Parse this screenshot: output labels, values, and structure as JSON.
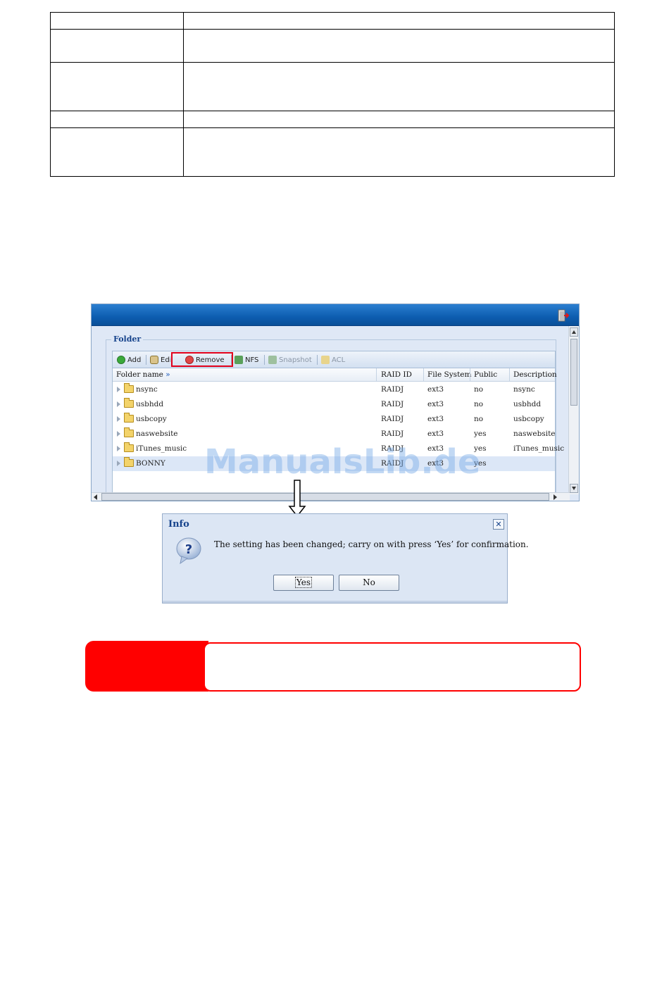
{
  "window": {
    "legend": "Folder",
    "toolbar": {
      "add": "Add",
      "edit": "Edit",
      "remove": "Remove",
      "nfs": "NFS",
      "snapshot": "Snapshot",
      "acl": "ACL"
    },
    "columns": [
      "Folder name",
      "RAID ID",
      "File System",
      "Public",
      "Description"
    ],
    "rows": [
      {
        "name": "nsync",
        "raid": "RAIDJ",
        "fs": "ext3",
        "public": "no",
        "desc": "nsync"
      },
      {
        "name": "usbhdd",
        "raid": "RAIDJ",
        "fs": "ext3",
        "public": "no",
        "desc": "usbhdd"
      },
      {
        "name": "usbcopy",
        "raid": "RAIDJ",
        "fs": "ext3",
        "public": "no",
        "desc": "usbcopy"
      },
      {
        "name": "naswebsite",
        "raid": "RAIDJ",
        "fs": "ext3",
        "public": "yes",
        "desc": "naswebsite"
      },
      {
        "name": "iTunes_music",
        "raid": "RAIDJ",
        "fs": "ext3",
        "public": "yes",
        "desc": "iTunes_music"
      },
      {
        "name": "BONNY",
        "raid": "RAIDJ",
        "fs": "ext3",
        "public": "yes",
        "desc": ""
      }
    ]
  },
  "watermark": "ManualsLib.de",
  "dialog": {
    "title": "Info",
    "close": "✕",
    "message": "The setting has been changed; carry on with press ‘Yes’ for confirmation.",
    "yes": "Yes",
    "no": "No"
  },
  "colors": {
    "title_bar": "#0d5db0",
    "highlight": "#e0001b",
    "note": "#ff0000"
  },
  "icons": {
    "logout": "exit-door-icon",
    "add": "add-circle-icon",
    "edit": "gear-icon",
    "remove": "remove-circle-icon",
    "nfs": "share-arrow-icon",
    "snapshot": "snapshot-icon",
    "acl": "pencil-folder-icon",
    "question": "question-bubble-icon"
  }
}
